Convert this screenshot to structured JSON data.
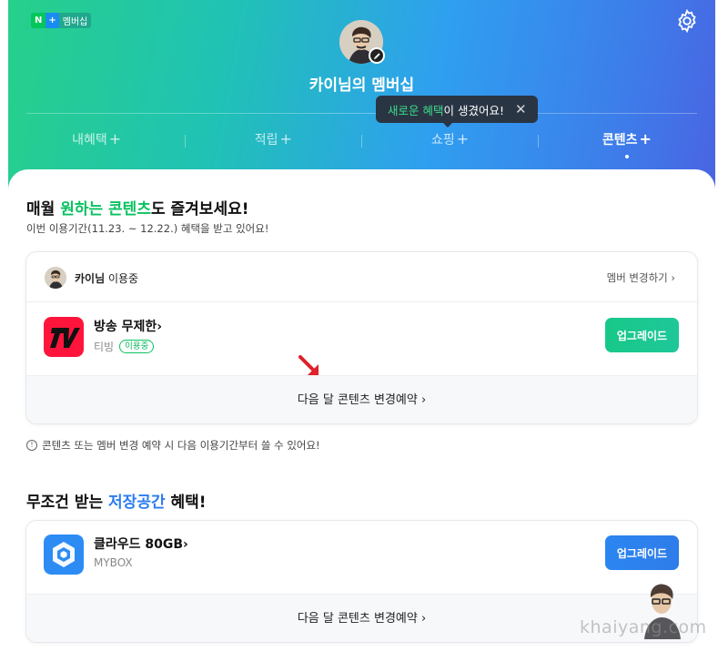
{
  "header": {
    "badge": {
      "n": "N",
      "plus": "+",
      "label": "멤버십"
    },
    "title": "카이님의 멤버십",
    "tabs": [
      {
        "label": "내혜택",
        "plus": "+"
      },
      {
        "label": "적립",
        "plus": "+"
      },
      {
        "label": "쇼핑",
        "plus": "+"
      },
      {
        "label": "콘텐츠",
        "plus": "+",
        "active": true
      }
    ],
    "tooltip": {
      "highlight": "새로운 혜택",
      "text": "이 생겼어요!",
      "close": "✕"
    }
  },
  "contents_section": {
    "title_pre": "매월 ",
    "title_hl1": "원하는 콘텐츠",
    "title_post": "도 즐겨보세요!",
    "subtitle": "이번 이용기간(11.23. ~ 12.22.) 혜택을 받고 있어요!",
    "member": {
      "name": "카이님",
      "status": " 이용중",
      "change": "멤버 변경하기 ›"
    },
    "service": {
      "name": "방송 무제한›",
      "provider": "티빙",
      "badge": "이용중",
      "button": "업그레이드"
    },
    "reserve": "다음 달 콘텐츠 변경예약 ›",
    "notice": "콘텐츠 또는 멤버 변경 예약 시 다음 이용기간부터 쓸 수 있어요!",
    "notice_icon": "!"
  },
  "storage_section": {
    "title_pre": "무조건 받는 ",
    "title_hl": "저장공간",
    "title_post": " 혜택!",
    "service": {
      "name": "클라우드 80GB›",
      "provider": "MYBOX",
      "button": "업그레이드"
    },
    "reserve": "다음 달 콘텐츠 변경예약 ›"
  },
  "watermark": "khaiyang.com",
  "colors": {
    "accent_green": "#09c25f",
    "accent_blue": "#2b7cf0",
    "tooltip_bg": "#2a3544"
  }
}
